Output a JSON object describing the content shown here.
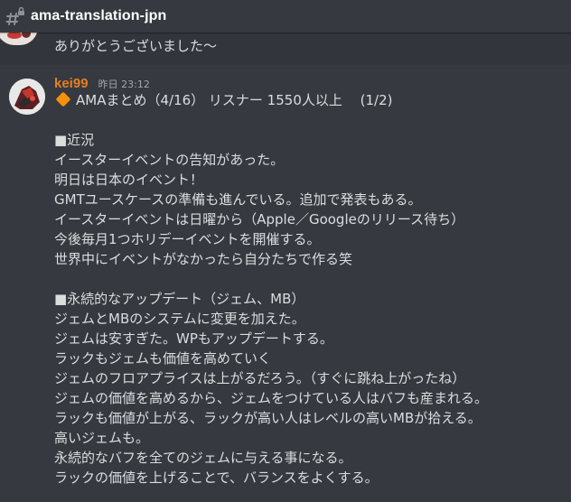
{
  "channel": {
    "name": "ama-translation-jpn",
    "icon": "hash-lock-icon"
  },
  "previous_message": {
    "text": "ありがとうございました〜"
  },
  "message": {
    "author": "kei99",
    "author_color": "#e67e22",
    "timestamp": "昨日 23:12",
    "title_line": "AMAまとめ（4/16） リスナー 1550人以上　 (1/2)",
    "section1": {
      "heading": "■近況",
      "lines": [
        "イースターイベントの告知があった。",
        "明日は日本のイベント！",
        "GMTユースケースの準備も進んでいる。追加で発表もある。",
        "イースターイベントは日曜から（Apple／Googleのリリース待ち）",
        "今後毎月1つホリデーイベントを開催する。",
        "世界中にイベントがなかったら自分たちで作る笑"
      ]
    },
    "section2": {
      "heading": "■永続的なアップデート（ジェム、MB）",
      "lines": [
        "ジェムとMBのシステムに変更を加えた。",
        "ジェムは安すぎた。WPもアップデートする。",
        "ラックもジェムも価値を高めていく",
        "ジェムのフロアプライスは上がるだろう。（すぐに跳ね上がったね）",
        "ジェムの価値を高めるから、ジェムをつけている人はバフも産まれる。",
        "ラックも価値が上がる、ラックが高い人はレベルの高いMBが拾える。",
        "高いジェムも。",
        "永続的なバフを全てのジェムに与える事になる。",
        "ラックの価値を上げることで、バランスをよくする。"
      ]
    }
  }
}
